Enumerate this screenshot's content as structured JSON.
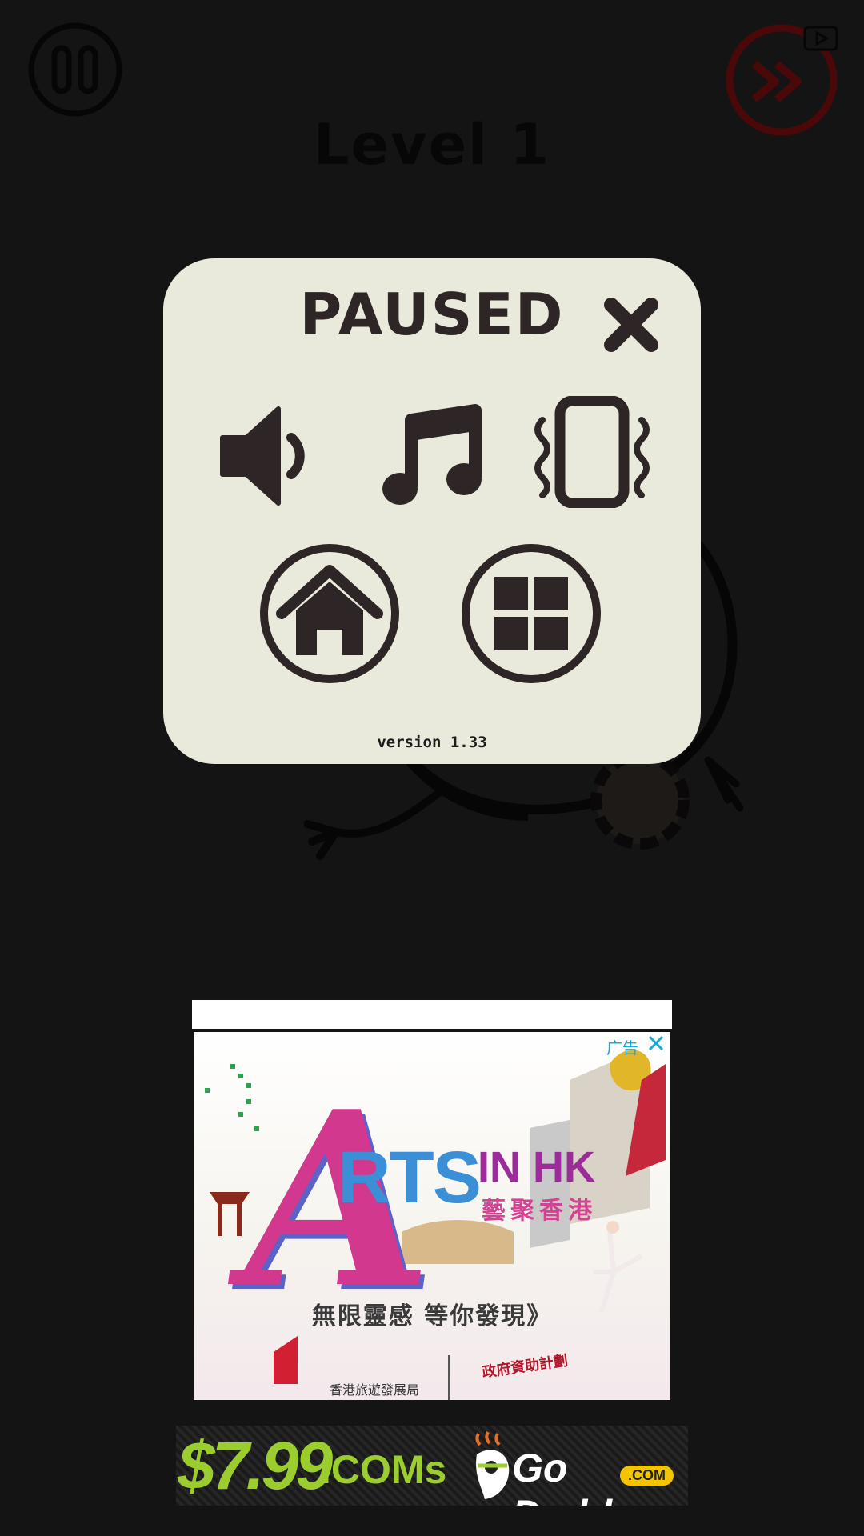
{
  "game": {
    "level_title": "Level 1",
    "colors": {
      "background": "#141414",
      "dialog": "#e9eadb",
      "icon": "#2e2626",
      "skip_accent": "#5a0a0a"
    }
  },
  "pause_dialog": {
    "title": "PAUSED",
    "version": "version 1.33",
    "buttons": [
      "close-icon",
      "sound-icon",
      "music-icon",
      "vibration-icon",
      "home-icon",
      "level-grid-icon"
    ]
  },
  "ads": {
    "banner": {
      "label": "广告",
      "headline_a": "A",
      "headline_rts": "RTS",
      "headline_inhk": "IN HK",
      "chinese_sub": "藝聚香港",
      "tagline": "無限靈感 等你發現》",
      "org_left": "香港旅遊發展局",
      "org_right": "政府資助計劃"
    },
    "bottom_banner": {
      "price": "$7.99",
      "domain_text": ".COMs",
      "brand": "Go Daddy",
      "dotcom": ".COM"
    }
  }
}
